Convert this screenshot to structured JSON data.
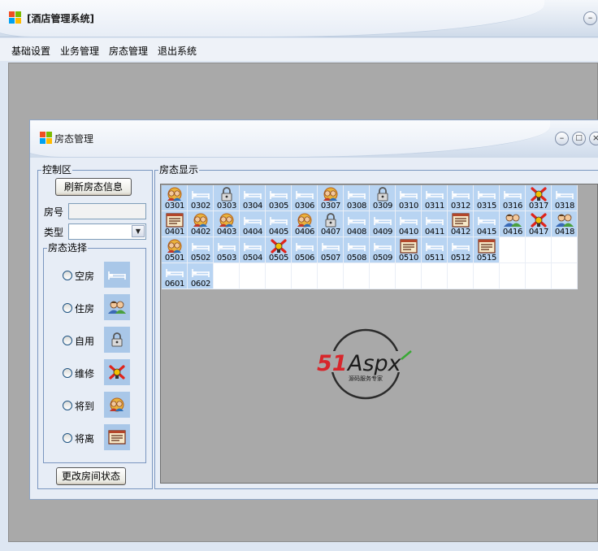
{
  "app": {
    "title": "[酒店管理系统]"
  },
  "menu": {
    "items": [
      "基础设置",
      "业务管理",
      "房态管理",
      "退出系统"
    ]
  },
  "child": {
    "title": "房态管理"
  },
  "control": {
    "group_label": "控制区",
    "refresh_label": "刷新房态信息",
    "room_no_label": "房号",
    "room_no_value": "",
    "type_label": "类型",
    "type_value": "",
    "status_group_label": "房态选择",
    "statuses": [
      {
        "label": "空房",
        "icon": "empty-bed-icon"
      },
      {
        "label": "住房",
        "icon": "occupied-people-icon"
      },
      {
        "label": "自用",
        "icon": "lock-icon"
      },
      {
        "label": "维修",
        "icon": "repair-icon"
      },
      {
        "label": "将到",
        "icon": "arriving-people-icon"
      },
      {
        "label": "将离",
        "icon": "departing-list-icon"
      }
    ],
    "change_label": "更改房间状态"
  },
  "display": {
    "group_label": "房态显示"
  },
  "rooms": [
    {
      "no": "0301",
      "status": "arriving"
    },
    {
      "no": "0302",
      "status": "empty"
    },
    {
      "no": "0303",
      "status": "self"
    },
    {
      "no": "0304",
      "status": "empty"
    },
    {
      "no": "0305",
      "status": "empty"
    },
    {
      "no": "0306",
      "status": "empty"
    },
    {
      "no": "0307",
      "status": "arriving"
    },
    {
      "no": "0308",
      "status": "empty"
    },
    {
      "no": "0309",
      "status": "self"
    },
    {
      "no": "0310",
      "status": "empty"
    },
    {
      "no": "0311",
      "status": "empty"
    },
    {
      "no": "0312",
      "status": "empty"
    },
    {
      "no": "0315",
      "status": "empty"
    },
    {
      "no": "0316",
      "status": "empty"
    },
    {
      "no": "0317",
      "status": "repair"
    },
    {
      "no": "0318",
      "status": "empty"
    },
    {
      "no": "0401",
      "status": "departing"
    },
    {
      "no": "0402",
      "status": "arriving"
    },
    {
      "no": "0403",
      "status": "arriving"
    },
    {
      "no": "0404",
      "status": "empty"
    },
    {
      "no": "0405",
      "status": "empty"
    },
    {
      "no": "0406",
      "status": "arriving"
    },
    {
      "no": "0407",
      "status": "self"
    },
    {
      "no": "0408",
      "status": "empty"
    },
    {
      "no": "0409",
      "status": "empty"
    },
    {
      "no": "0410",
      "status": "empty"
    },
    {
      "no": "0411",
      "status": "empty"
    },
    {
      "no": "0412",
      "status": "departing"
    },
    {
      "no": "0415",
      "status": "empty"
    },
    {
      "no": "0416",
      "status": "occupied"
    },
    {
      "no": "0417",
      "status": "repair"
    },
    {
      "no": "0418",
      "status": "occupied"
    },
    {
      "no": "0501",
      "status": "arriving"
    },
    {
      "no": "0502",
      "status": "empty"
    },
    {
      "no": "0503",
      "status": "empty"
    },
    {
      "no": "0504",
      "status": "empty"
    },
    {
      "no": "0505",
      "status": "repair"
    },
    {
      "no": "0506",
      "status": "empty"
    },
    {
      "no": "0507",
      "status": "empty"
    },
    {
      "no": "0508",
      "status": "empty"
    },
    {
      "no": "0509",
      "status": "empty"
    },
    {
      "no": "0510",
      "status": "departing"
    },
    {
      "no": "0511",
      "status": "empty"
    },
    {
      "no": "0512",
      "status": "empty"
    },
    {
      "no": "0515",
      "status": "departing"
    },
    {
      "no": "0601",
      "status": "empty"
    },
    {
      "no": "0602",
      "status": "empty"
    }
  ],
  "watermark": {
    "brand": "51Aspx",
    "tagline": "源码服务专家"
  },
  "colors": {
    "room_bg": "#b8d4f2",
    "mdi_bg": "#a9a9a9",
    "frame": "#7a96bf"
  }
}
